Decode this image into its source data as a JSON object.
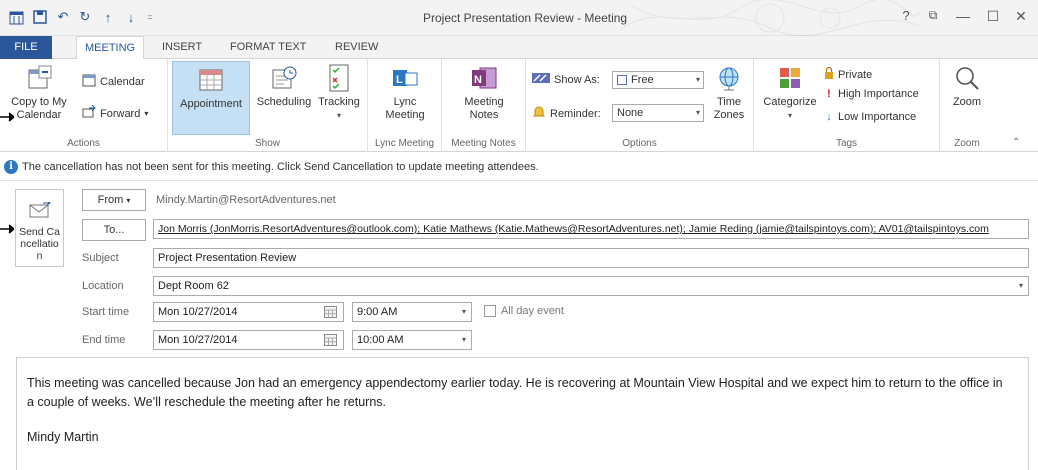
{
  "window": {
    "title": "Project Presentation Review - Meeting",
    "help": "?",
    "restore": "⧉",
    "minimize": "—",
    "maximize": "☐",
    "close": "✕"
  },
  "tabs": [
    "FILE",
    "MEETING",
    "INSERT",
    "FORMAT TEXT",
    "REVIEW"
  ],
  "ribbon": {
    "actions": {
      "copy_to_calendar": "Copy to My Calendar",
      "calendar": "Calendar",
      "forward": "Forward",
      "label": "Actions"
    },
    "show": {
      "appointment": "Appointment",
      "scheduling": "Scheduling",
      "tracking": "Tracking",
      "label": "Show"
    },
    "lync": {
      "button": "Lync Meeting",
      "label": "Lync Meeting"
    },
    "notes": {
      "button": "Meeting Notes",
      "label": "Meeting Notes"
    },
    "options": {
      "show_as_label": "Show As:",
      "show_as_value": "Free",
      "reminder_label": "Reminder:",
      "reminder_value": "None",
      "time_zones": "Time Zones",
      "label": "Options"
    },
    "tags": {
      "categorize": "Categorize",
      "private": "Private",
      "high_importance": "High Importance",
      "low_importance": "Low Importance",
      "label": "Tags"
    },
    "zoom": {
      "button": "Zoom",
      "label": "Zoom"
    }
  },
  "info_message": "The cancellation has not been sent for this meeting. Click Send Cancellation to update meeting attendees.",
  "form": {
    "send_button": "Send Cancellation",
    "from_button": "From",
    "from_value": "Mindy.Martin@ResortAdventures.net",
    "to_button": "To...",
    "to_value": "Jon Morris (JonMorris.ResortAdventures@outlook.com); Katie Mathews (Katie.Mathews@ResortAdventures.net); Jamie Reding (jamie@tailspintoys.com); AV01@tailspintoys.com",
    "subject_label": "Subject",
    "subject_value": "Project Presentation Review",
    "location_label": "Location",
    "location_value": "Dept Room 62",
    "start_label": "Start time",
    "start_date": "Mon 10/27/2014",
    "start_time": "9:00 AM",
    "all_day": "All day event",
    "end_label": "End time",
    "end_date": "Mon 10/27/2014",
    "end_time": "10:00 AM"
  },
  "body": {
    "text": "This meeting was cancelled because Jon had an emergency appendectomy earlier today. He is recovering at Mountain View Hospital and we expect him to return to the office in a couple of weeks. We’ll reschedule the meeting after he returns.",
    "signature": "Mindy Martin"
  },
  "icons": [
    "app-calendar-icon",
    "save-icon",
    "undo-icon",
    "redo-icon",
    "up-icon",
    "down-icon",
    "info-icon",
    "send-icon",
    "calendar-picker-icon",
    "dropdown-icon",
    "globe-icon",
    "lock-icon",
    "exclamation-icon",
    "down-arrow-icon",
    "magnifier-icon"
  ],
  "colors": {
    "accent": "#2b579a",
    "active_button": "#c5dff5",
    "info_icon": "#2b78c5"
  }
}
